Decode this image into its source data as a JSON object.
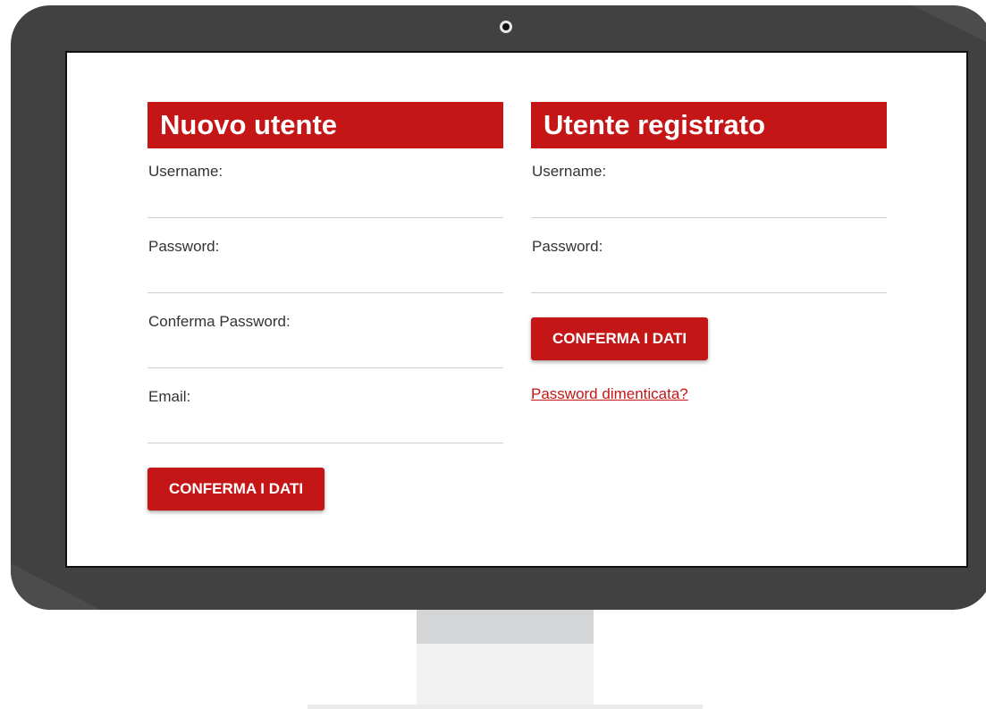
{
  "new_user": {
    "title": "Nuovo utente",
    "fields": [
      {
        "label": "Username:",
        "value": ""
      },
      {
        "label": "Password:",
        "value": ""
      },
      {
        "label": "Conferma Password:",
        "value": ""
      },
      {
        "label": "Email:",
        "value": ""
      }
    ],
    "submit_label": "CONFERMA I DATI"
  },
  "registered_user": {
    "title": "Utente registrato",
    "fields": [
      {
        "label": "Username:",
        "value": ""
      },
      {
        "label": "Password:",
        "value": ""
      }
    ],
    "submit_label": "CONFERMA I DATI",
    "forgot_password_label": "Password dimenticata?"
  },
  "colors": {
    "accent": "#c41616",
    "monitor_frame": "#414141",
    "stand": "#d4d5d7"
  }
}
